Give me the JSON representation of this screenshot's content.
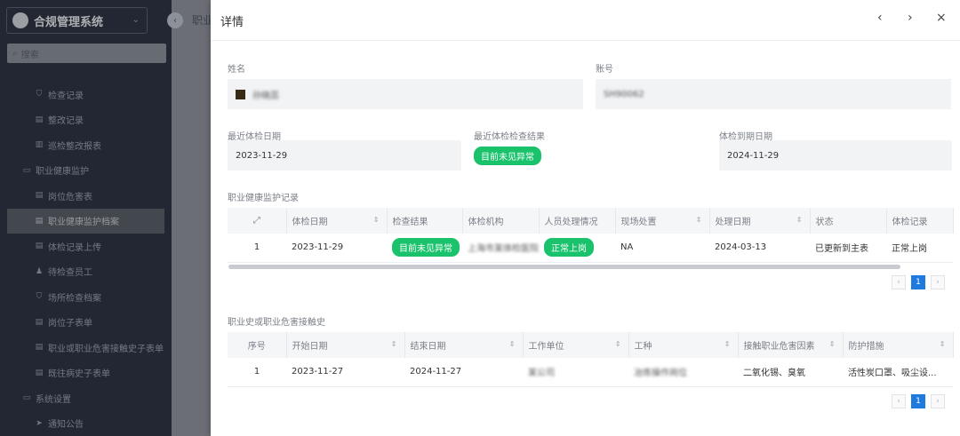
{
  "sidebar": {
    "brand": "合规管理系统",
    "search_placeholder": "搜索",
    "items": [
      {
        "label": "检查记录",
        "icon": "shield-icon",
        "group": false,
        "active": false
      },
      {
        "label": "整改记录",
        "icon": "doc-icon",
        "group": false,
        "active": false
      },
      {
        "label": "巡检整改报表",
        "icon": "bar-chart-icon",
        "group": false,
        "active": false
      },
      {
        "label": "职业健康监护",
        "icon": "folder-icon",
        "group": true,
        "active": false
      },
      {
        "label": "岗位危害表",
        "icon": "doc-icon",
        "group": false,
        "active": false
      },
      {
        "label": "职业健康监护档案",
        "icon": "doc-icon",
        "group": false,
        "active": true
      },
      {
        "label": "体检记录上传",
        "icon": "doc-icon",
        "group": false,
        "active": false
      },
      {
        "label": "待检查员工",
        "icon": "user-icon",
        "group": false,
        "active": false
      },
      {
        "label": "场所检查档案",
        "icon": "shield-icon",
        "group": false,
        "active": false
      },
      {
        "label": "岗位子表单",
        "icon": "doc-icon",
        "group": false,
        "active": false
      },
      {
        "label": "职业或职业危害接触史子表单",
        "icon": "doc-icon",
        "group": false,
        "active": false
      },
      {
        "label": "既往病史子表单",
        "icon": "doc-icon",
        "group": false,
        "active": false
      },
      {
        "label": "系统设置",
        "icon": "folder-icon",
        "group": true,
        "active": false
      },
      {
        "label": "通知公告",
        "icon": "send-icon",
        "group": false,
        "active": false
      }
    ]
  },
  "behind": {
    "tab_label": "职业"
  },
  "drawer": {
    "title": "详情",
    "prev_icon": "‹",
    "next_icon": "›",
    "close_icon": "×"
  },
  "form": {
    "name_label": "姓名",
    "name_value": "孙晓蕊",
    "account_label": "账号",
    "account_value": "SH90062",
    "last_exam_date_label": "最近体检日期",
    "last_exam_date_value": "2023-11-29",
    "last_exam_result_label": "最近体检检查结果",
    "last_exam_result_value": "目前未见异常",
    "exam_due_date_label": "体检到期日期",
    "exam_due_date_value": "2024-11-29"
  },
  "monitor_table": {
    "title": "职业健康监护记录",
    "columns": [
      "",
      "体检日期",
      "检查结果",
      "体检机构",
      "人员处理情况",
      "现场处置",
      "处理日期",
      "状态",
      "体检记录"
    ],
    "rows": [
      {
        "idx": "1",
        "exam_date": "2023-11-29",
        "result": "目前未见异常",
        "org": "上海市某体检医院",
        "handling": "正常上岗",
        "onsite": "NA",
        "handle_date": "2024-03-13",
        "status": "已更新到主表",
        "record": "正常上岗"
      }
    ],
    "page": "1"
  },
  "history_table": {
    "title": "职业史或职业危害接触史",
    "columns": [
      "序号",
      "开始日期",
      "结束日期",
      "工作单位",
      "工种",
      "接触职业危害因素",
      "防护措施"
    ],
    "rows": [
      {
        "idx": "1",
        "start": "2023-11-27",
        "end": "2024-11-27",
        "company": "某公司",
        "job": "冶炼操作岗位",
        "hazard": "二氧化锡、臭氧",
        "protection": "活性炭口罩、吸尘设..."
      }
    ],
    "page": "1"
  },
  "pager": {
    "prev": "‹",
    "next": "›"
  }
}
